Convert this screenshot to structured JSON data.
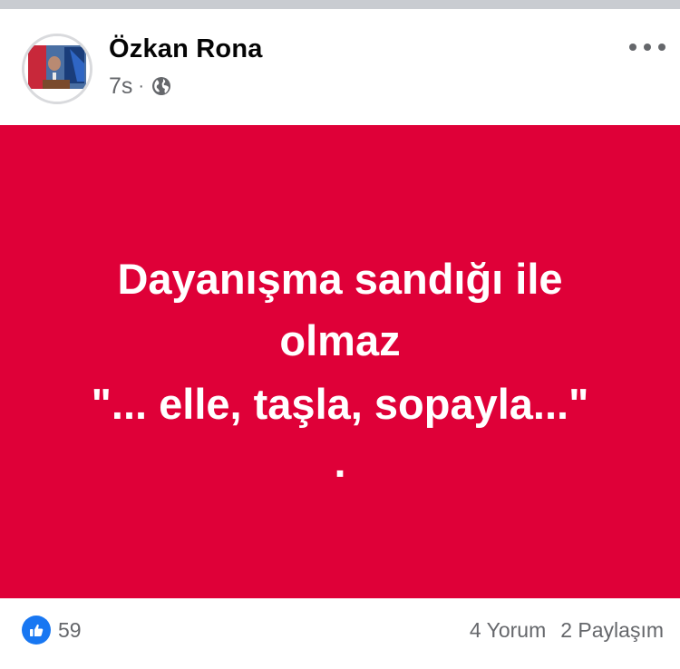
{
  "post": {
    "author_name": "Özkan Rona",
    "time": "7s",
    "separator": "·",
    "audience_icon": "globe-icon",
    "more_icon": "more-horizontal-icon",
    "background_color": "#df0038",
    "text_color": "#ffffff",
    "text_lines": [
      "Dayanışma sandığı ile",
      "olmaz",
      "\"... elle, taşla, sopayla...\"",
      "."
    ]
  },
  "footer": {
    "reaction_icon": "like-icon",
    "reaction_count": "59",
    "comments": "4 Yorum",
    "shares": "2 Paylaşım"
  },
  "colors": {
    "like_blue": "#1877f2",
    "secondary_text": "#65676b",
    "primary_text": "#050505"
  }
}
